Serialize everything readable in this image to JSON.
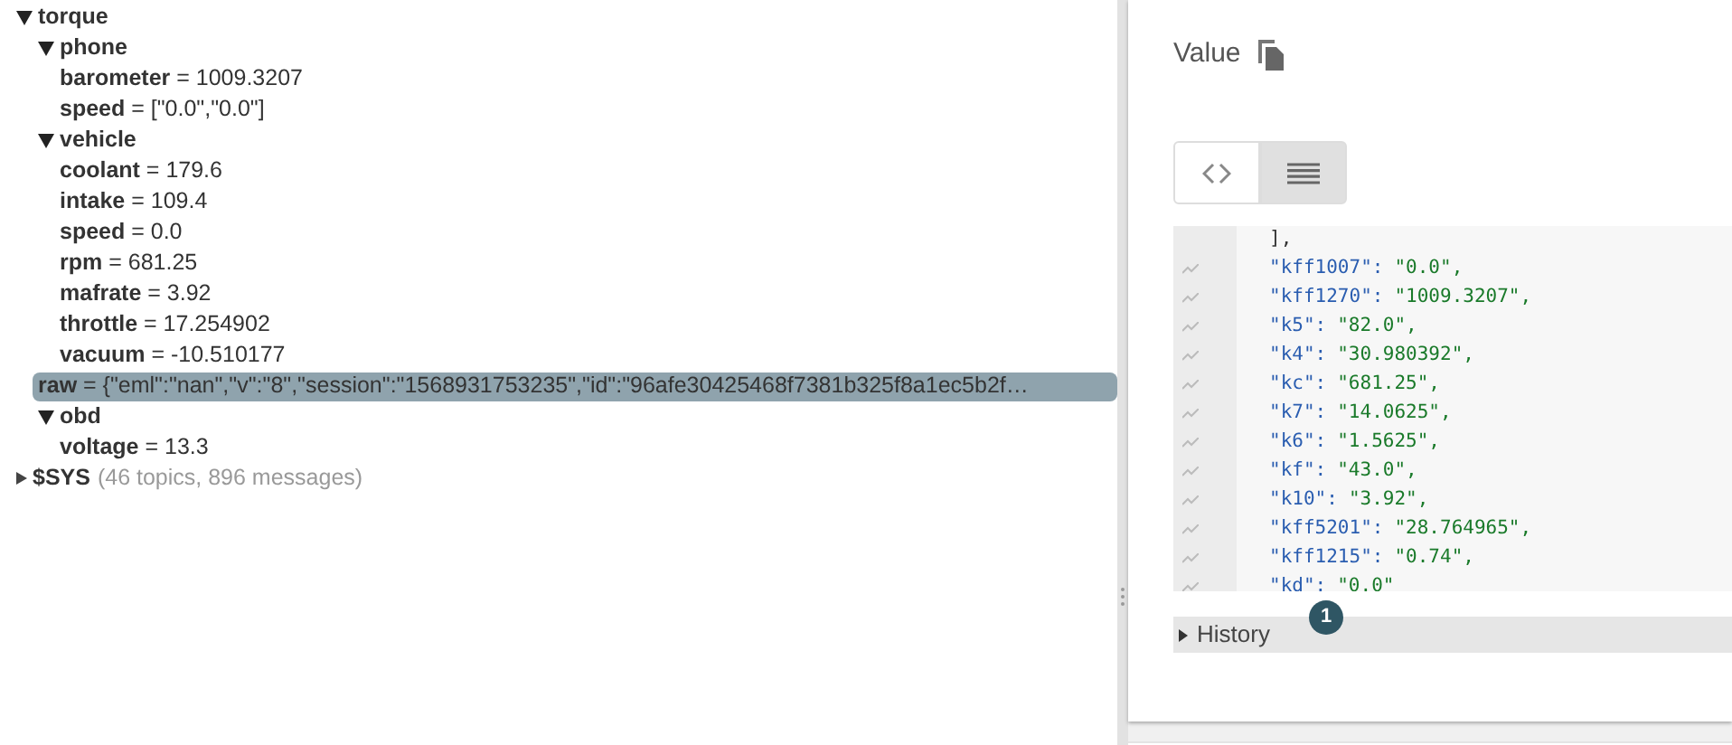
{
  "tree": [
    {
      "key": "torque",
      "expanded": true,
      "selected": false,
      "children": [
        {
          "key": "phone",
          "expanded": true,
          "selected": false,
          "children": [
            {
              "label": "**barometer** = 1009.3207",
              "selected": false
            },
            {
              "label": "**speed** = [\"0.0\",\"0.0\"]",
              "selected": false
            }
          ]
        },
        {
          "key": "vehicle",
          "expanded": true,
          "selected": false,
          "children": [
            {
              "label": "**coolant** = 179.6",
              "selected": false
            },
            {
              "label": "**intake** = 109.4",
              "selected": false
            },
            {
              "label": "**speed** = 0.0",
              "selected": false
            },
            {
              "label": "**rpm** = 681.25",
              "selected": false
            },
            {
              "label": "**mafrate** = 3.92",
              "selected": false
            },
            {
              "label": "**throttle** = 17.254902",
              "selected": false
            },
            {
              "label": "**vacuum** = -10.510177",
              "selected": false
            }
          ]
        },
        {
          "label": "**raw** = {\"eml\":\"nan\",\"v\":\"8\",\"session\":\"1568931753235\",\"id\":\"96afe30425468f7381b325f8a1ec5b2f…",
          "selected": true
        },
        {
          "key": "obd",
          "expanded": true,
          "selected": false,
          "children": [
            {
              "label": "**voltage** = 13.3",
              "selected": false
            }
          ]
        }
      ]
    },
    {
      "key": "$SYS",
      "summary": "(46 topics, 896 messages)",
      "expanded": false,
      "selected": false
    }
  ],
  "value_panel": {
    "title": "Value",
    "view_modes": [
      {
        "kind": "code",
        "selected": false
      },
      {
        "kind": "list",
        "selected": true
      }
    ],
    "code_lines": [
      {
        "kind": "plain",
        "text": "],"
      },
      {
        "kind": "entry",
        "key": "\"kff1007\":",
        "value": "\"0.0\","
      },
      {
        "kind": "entry",
        "key": "\"kff1270\":",
        "value": "\"1009.3207\","
      },
      {
        "kind": "entry",
        "key": "\"k5\":",
        "value": "\"82.0\","
      },
      {
        "kind": "entry",
        "key": "\"k4\":",
        "value": "\"30.980392\","
      },
      {
        "kind": "entry",
        "key": "\"kc\":",
        "value": "\"681.25\","
      },
      {
        "kind": "entry",
        "key": "\"k7\":",
        "value": "\"14.0625\","
      },
      {
        "kind": "entry",
        "key": "\"k6\":",
        "value": "\"1.5625\","
      },
      {
        "kind": "entry",
        "key": "\"kf\":",
        "value": "\"43.0\","
      },
      {
        "kind": "entry",
        "key": "\"k10\":",
        "value": "\"3.92\","
      },
      {
        "kind": "entry",
        "key": "\"kff5201\":",
        "value": "\"28.764965\","
      },
      {
        "kind": "entry",
        "key": "\"kff1215\":",
        "value": "\"0.74\","
      },
      {
        "kind": "entry",
        "key": "\"kd\":",
        "value": "\"0.0\""
      }
    ],
    "history": {
      "label": "History",
      "expanded": false,
      "badge": "1"
    }
  }
}
